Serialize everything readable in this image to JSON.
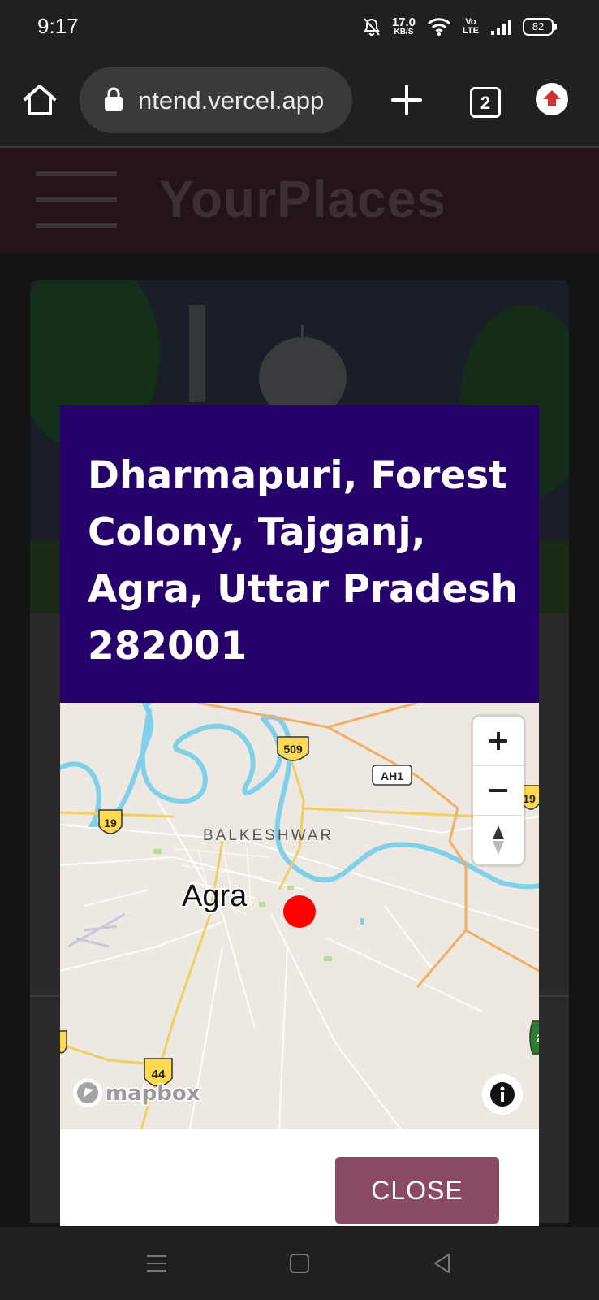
{
  "status_bar": {
    "time": "9:17",
    "net_speed_value": "17.0",
    "net_speed_unit": "KB/S",
    "volte_top": "Vo",
    "volte_bottom": "LTE",
    "battery": "82",
    "icons": [
      "bell-mute-icon",
      "wifi-icon",
      "volte-icon",
      "signal-icon",
      "battery-icon"
    ]
  },
  "browser": {
    "url": "ntend.vercel.app",
    "tab_count": "2",
    "icons": [
      "home-icon",
      "lock-icon",
      "plus-icon",
      "tab-switcher-icon",
      "update-icon"
    ]
  },
  "app": {
    "title": "YourPlaces"
  },
  "modal": {
    "title": "Dharmapuri, Forest Colony, Tajganj, Agra, Uttar Pradesh 282001",
    "close_label": "CLOSE",
    "header_color": "#26006b",
    "button_color": "#8b4a64"
  },
  "map": {
    "city_label": "Agra",
    "area_label": "BALKESHWAR",
    "road_shields": [
      "509",
      "AH1",
      "19",
      "19",
      "44",
      "2"
    ],
    "marker_color": "#ff0000",
    "attribution": "mapbox",
    "controls": [
      "zoom-in-icon",
      "zoom-out-icon",
      "compass-icon",
      "info-icon"
    ]
  },
  "nav_bar": {
    "icons": [
      "menu-icon",
      "home-square-icon",
      "back-triangle-icon"
    ]
  }
}
